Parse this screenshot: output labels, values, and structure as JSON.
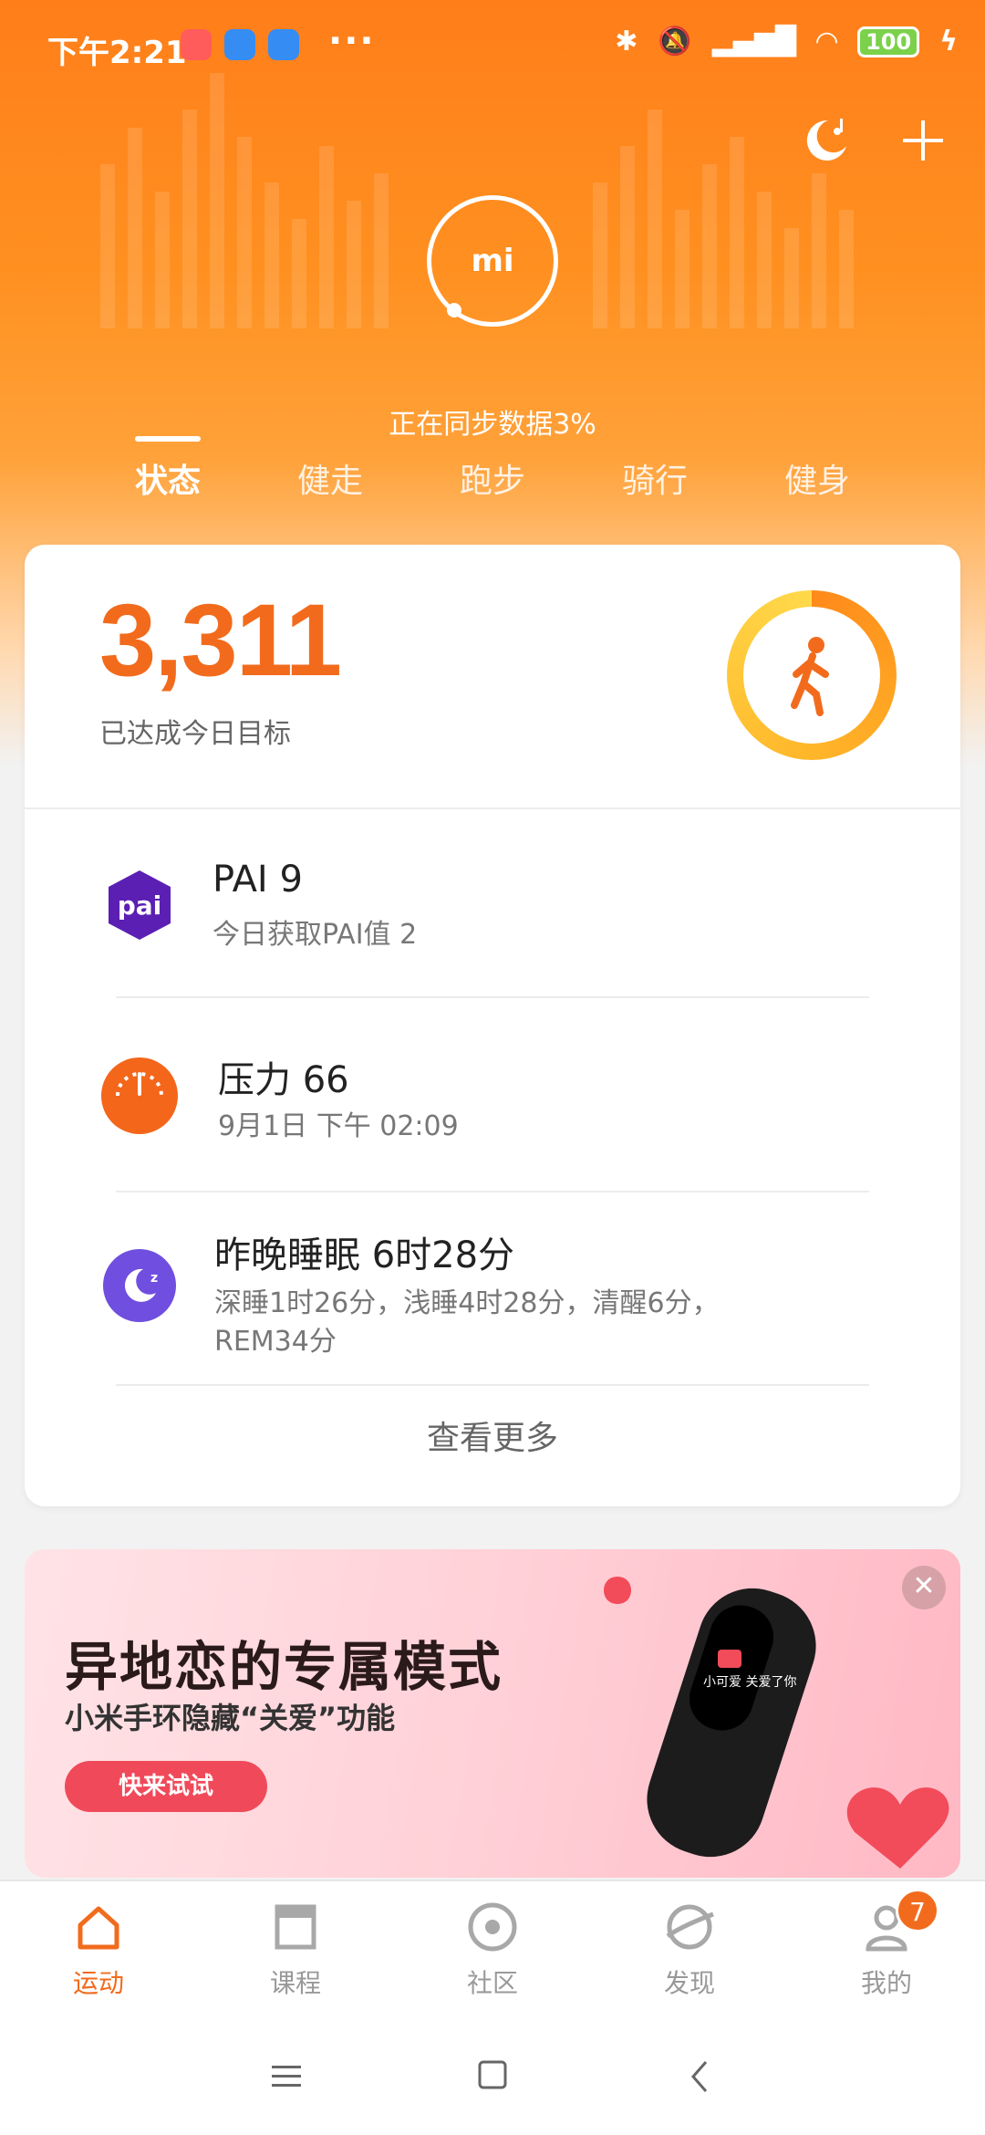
{
  "status_bar": {
    "time": "下午2:21",
    "more": "···",
    "battery": "100"
  },
  "header": {
    "logo": "mi",
    "sync_text": "正在同步数据3%",
    "tabs": [
      "状态",
      "健走",
      "跑步",
      "骑行",
      "健身"
    ],
    "active_tab": "状态"
  },
  "steps": {
    "count": "3,311",
    "caption": "已达成今日目标",
    "goal_progress": 1.0
  },
  "metrics": [
    {
      "title": "PAI  9",
      "sub": "今日获取PAI值  2",
      "icon": "pai-icon",
      "color": "#5b1fb3"
    },
    {
      "title": "压力  66",
      "sub": "9月1日  下午  02:09",
      "icon": "stress-gauge-icon",
      "color": "#f4661a"
    },
    {
      "title": "昨晚睡眠  6时28分",
      "sub": "深睡1时26分，浅睡4时28分，清醒6分，",
      "sub2": "REM34分",
      "icon": "sleep-moon-icon",
      "color": "#6f4ee0"
    }
  ],
  "pai_icon_text": "pai",
  "see_more": "查看更多",
  "banner": {
    "title": "异地恋的专属模式",
    "subtitle": "小米手环隐藏“关爱”功能",
    "button": "快来试试",
    "device_text": "小可爱\n关爱了你"
  },
  "bottom_nav": [
    {
      "label": "运动",
      "icon": "home-icon",
      "active": true
    },
    {
      "label": "课程",
      "icon": "course-icon",
      "active": false
    },
    {
      "label": "社区",
      "icon": "community-icon",
      "active": false
    },
    {
      "label": "发现",
      "icon": "discover-icon",
      "active": false
    },
    {
      "label": "我的",
      "icon": "profile-icon",
      "active": false,
      "badge": "7"
    }
  ],
  "colors": {
    "accent": "#f26b1d",
    "hero_top": "#ff7e1a",
    "banner_button": "#f04a5a"
  }
}
